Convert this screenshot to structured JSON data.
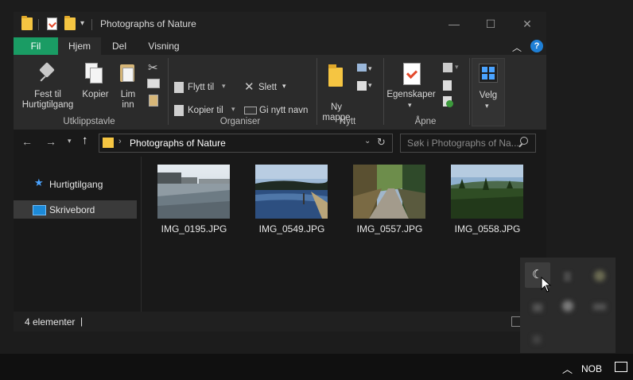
{
  "window": {
    "title": "Photographs of Nature",
    "controls": {
      "minimize": "—",
      "maximize": "☐",
      "close": "✕"
    }
  },
  "tabs": [
    "Fil",
    "Hjem",
    "Del",
    "Visning"
  ],
  "ribbon": {
    "clipboard": {
      "group_name": "Utklippstavle",
      "pin_label_1": "Fest til",
      "pin_label_2": "Hurtigtilgang",
      "copy_label": "Kopier",
      "paste_label_1": "Lim",
      "paste_label_2": "inn"
    },
    "organize": {
      "group_name": "Organiser",
      "move_to": "Flytt til",
      "copy_to": "Kopier til",
      "delete": "Slett",
      "rename": "Gi nytt navn"
    },
    "new": {
      "group_name": "Nytt",
      "new_folder_1": "Ny",
      "new_folder_2": "mappe"
    },
    "open": {
      "group_name": "Åpne",
      "properties": "Egenskaper"
    },
    "select": {
      "select_label": "Velg"
    }
  },
  "address": {
    "path": "Photographs of Nature",
    "search_placeholder": "Søk i Photographs of Na..."
  },
  "nav": {
    "items": [
      {
        "label": "Hurtigtilgang",
        "icon": "star-icon"
      },
      {
        "label": "Skrivebord",
        "icon": "desktop-icon"
      }
    ]
  },
  "files": [
    {
      "name": "IMG_0195.JPG"
    },
    {
      "name": "IMG_0549.JPG"
    },
    {
      "name": "IMG_0557.JPG"
    },
    {
      "name": "IMG_0558.JPG"
    }
  ],
  "status": {
    "count": "4 elementer",
    "separator": "|"
  },
  "taskbar": {
    "language": "NOB"
  },
  "colors": {
    "accent_green": "#1a9c64",
    "help_blue": "#1e7fd6",
    "folder_yellow": "#f5c542"
  }
}
